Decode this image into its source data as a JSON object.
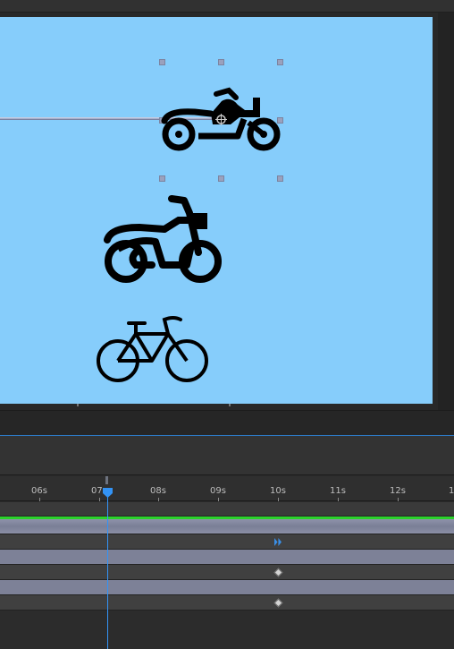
{
  "viewer": {
    "background_color": "#86cdfb",
    "icons": [
      "motorcycle-icon",
      "motorcycle-icon",
      "bicycle-icon"
    ]
  },
  "timeline": {
    "ticks": [
      "06s",
      "07s",
      "08s",
      "09s",
      "10s",
      "11s",
      "12s",
      "1"
    ],
    "current_time_label": "07s",
    "playhead_color": "#3393f5",
    "work_area_color": "#2bd12b"
  },
  "colors": {
    "layer_bar": "#7d8197",
    "property_row": "#404040",
    "accent_blue": "#2d79c4"
  }
}
